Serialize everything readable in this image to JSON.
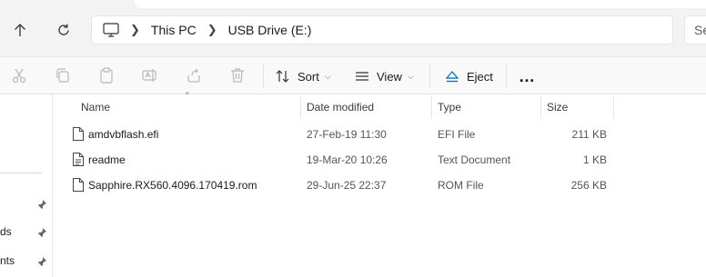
{
  "breadcrumb": {
    "items": [
      "This PC",
      "USB Drive (E:)"
    ]
  },
  "search": {
    "placeholder": "Se"
  },
  "toolbar": {
    "icons": [
      "cut-icon",
      "copy-icon",
      "paste-icon",
      "rename-icon",
      "share-icon",
      "delete-icon"
    ],
    "sort_label": "Sort",
    "view_label": "View",
    "eject_label": "Eject",
    "more_label": "…"
  },
  "left_pane": {
    "items": [
      "ds",
      "nts"
    ]
  },
  "columns": {
    "name": "Name",
    "date": "Date modified",
    "type": "Type",
    "size": "Size"
  },
  "files": [
    {
      "name": "amdvbflash.efi",
      "date": "27-Feb-19 11:30",
      "type": "EFI File",
      "size": "211 KB"
    },
    {
      "name": "readme",
      "date": "19-Mar-20 10:26",
      "type": "Text Document",
      "size": "1 KB"
    },
    {
      "name": "Sapphire.RX560.4096.170419.rom",
      "date": "29-Jun-25 22:37",
      "type": "ROM File",
      "size": "256 KB"
    }
  ],
  "colors": {
    "accent": "#0067c0",
    "disabled_icon": "#b8b8b8"
  }
}
